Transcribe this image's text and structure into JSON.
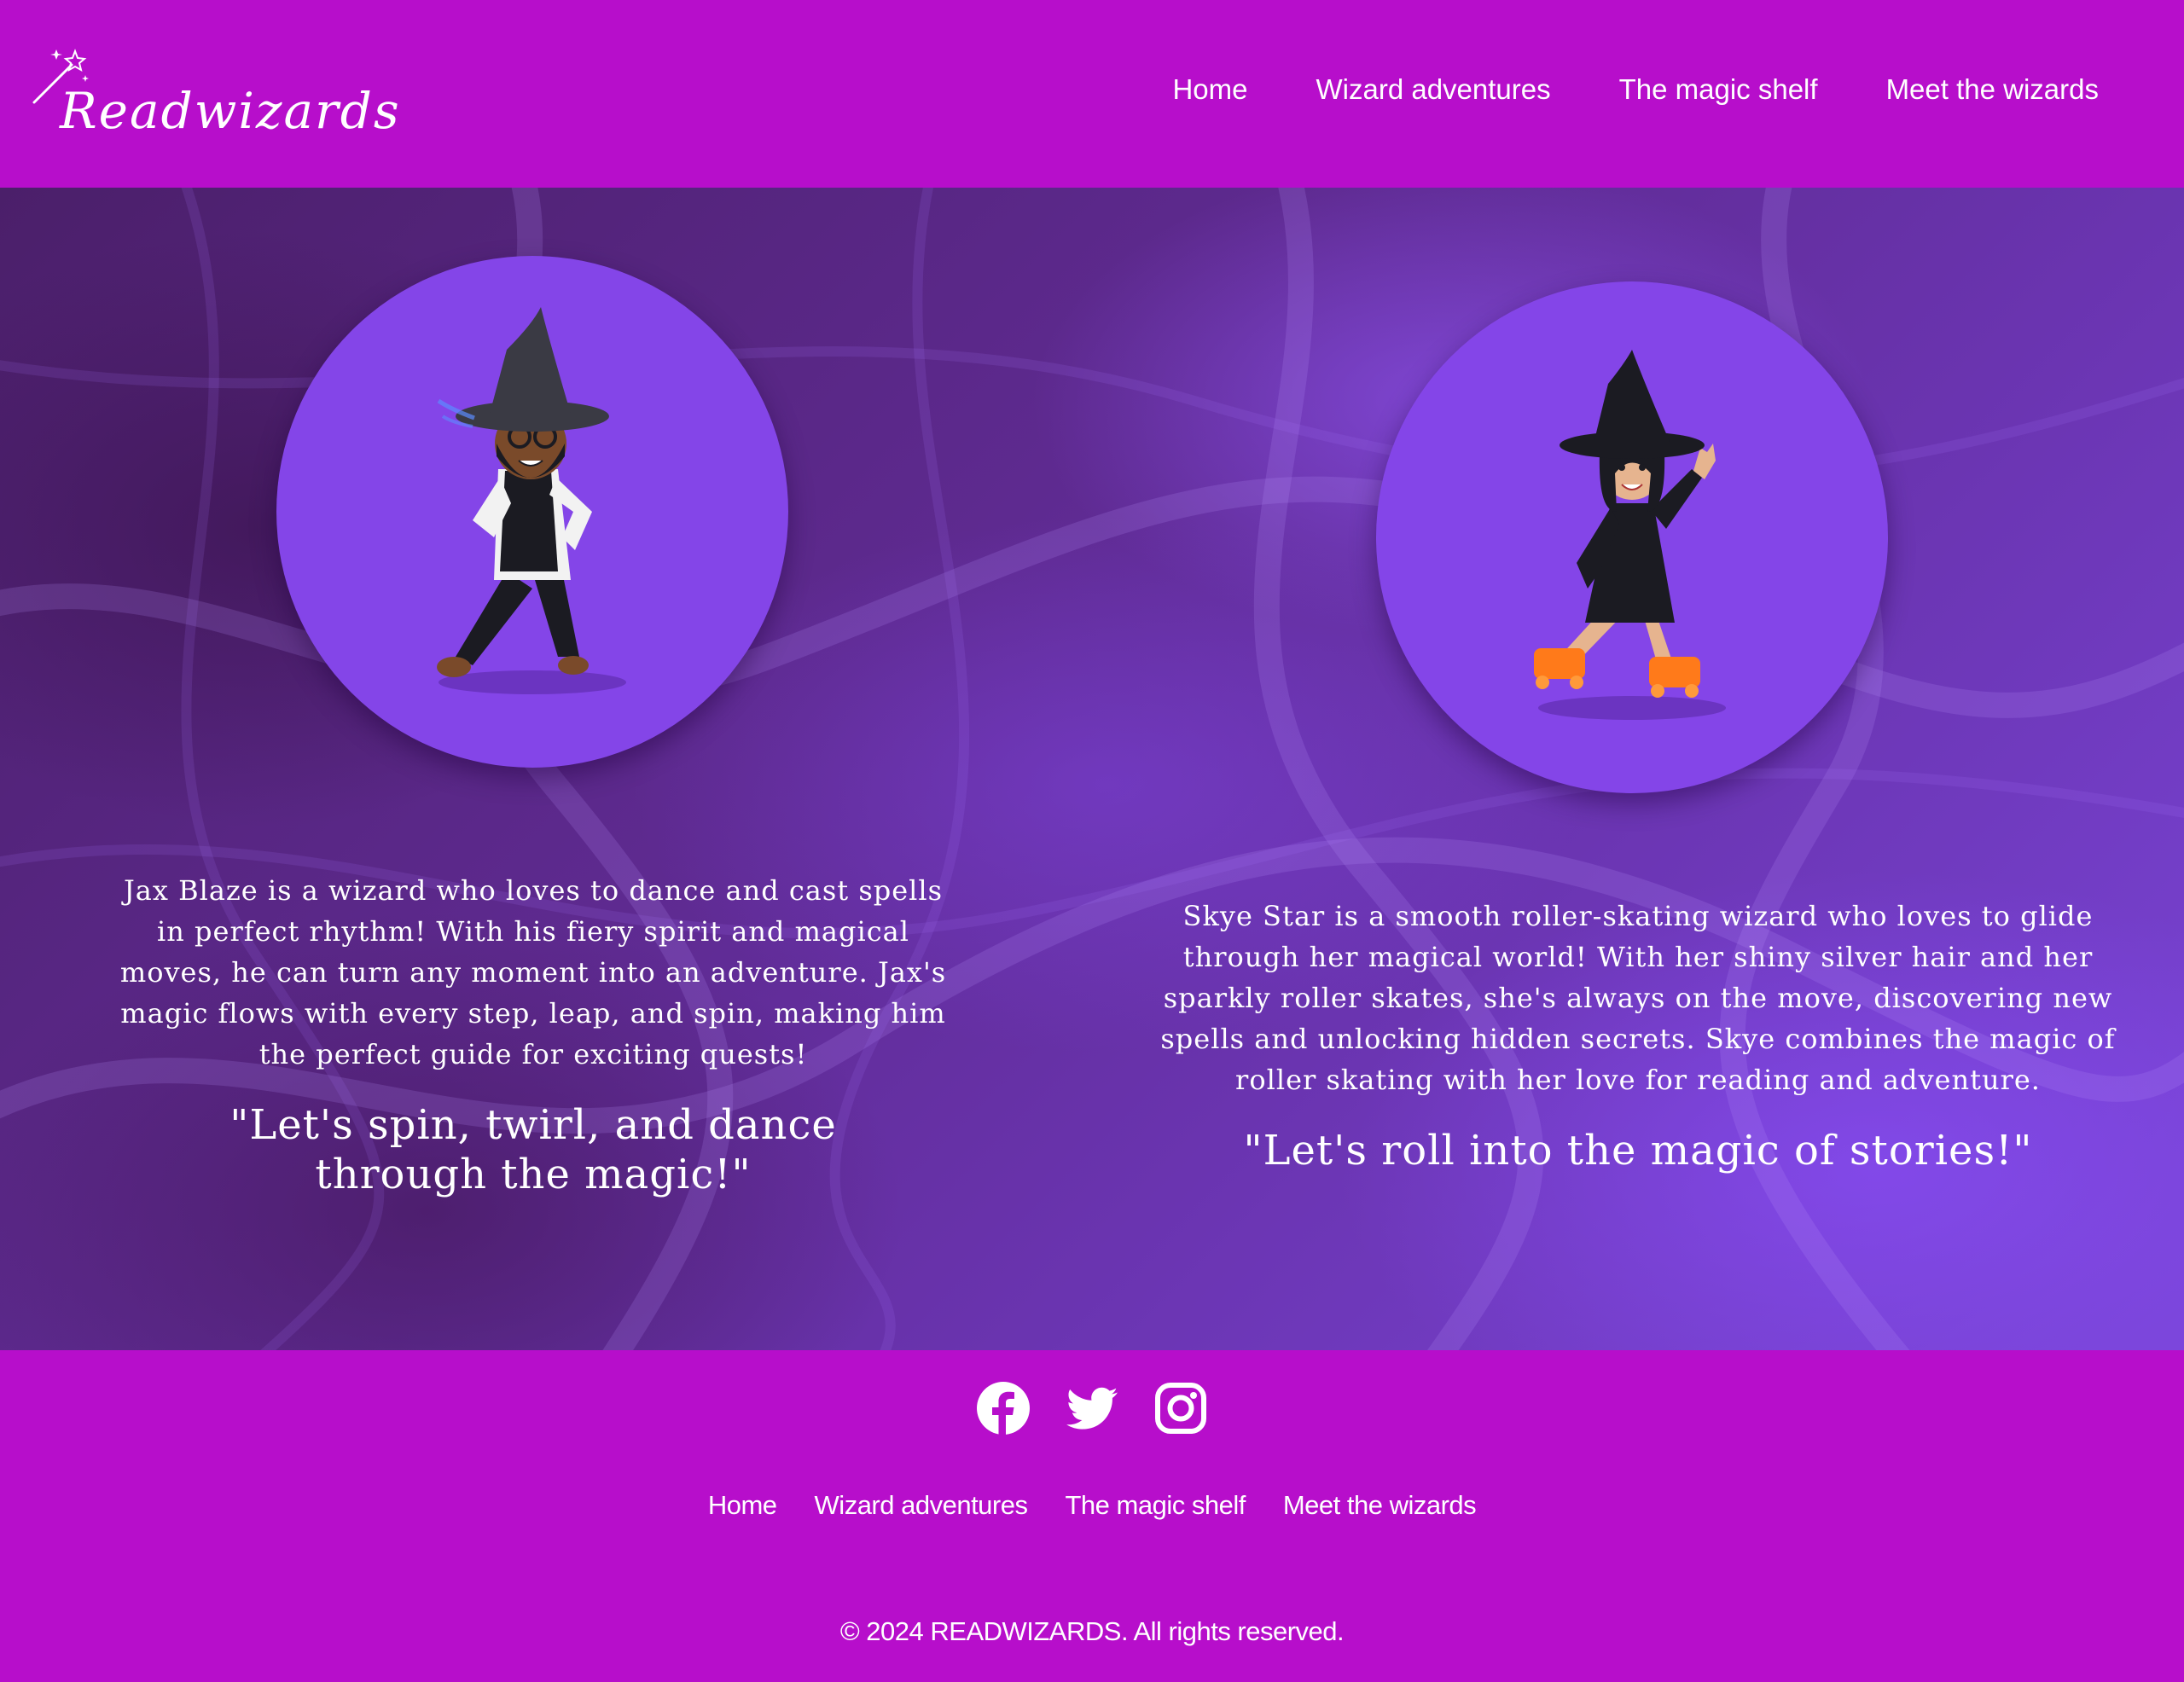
{
  "header": {
    "logo_text": "Readwizards",
    "nav": [
      {
        "label": "Home"
      },
      {
        "label": "Wizard adventures"
      },
      {
        "label": "The magic shelf"
      },
      {
        "label": "Meet the wizards"
      }
    ]
  },
  "wizards": [
    {
      "bio": "Jax Blaze is a wizard who loves to dance and cast spells in perfect rhythm! With his fiery spirit and magical moves, he can turn any moment into an adventure. Jax's magic flows with every step, leap, and spin, making him the perfect guide for exciting quests!",
      "quote": "\"Let's spin, twirl, and dance through the magic!\""
    },
    {
      "bio": "Skye Star is a smooth roller-skating wizard who loves to glide through her magical world! With her shiny silver hair and her sparkly roller skates, she's always on the move, discovering new spells and unlocking hidden secrets. Skye combines the magic of roller skating with her love for reading and adventure.",
      "quote": "\"Let's roll into the magic of stories!\""
    }
  ],
  "footer": {
    "social": [
      {
        "icon": "facebook-icon"
      },
      {
        "icon": "twitter-icon"
      },
      {
        "icon": "instagram-icon"
      }
    ],
    "nav": [
      {
        "label": "Home"
      },
      {
        "label": "Wizard adventures"
      },
      {
        "label": "The magic shelf"
      },
      {
        "label": "Meet the wizards"
      }
    ],
    "copyright": "© 2024 READWIZARDS. All rights reserved."
  },
  "colors": {
    "brand": "#b70ecb",
    "avatar_bg": "#8445e8",
    "text": "#ffffff"
  }
}
